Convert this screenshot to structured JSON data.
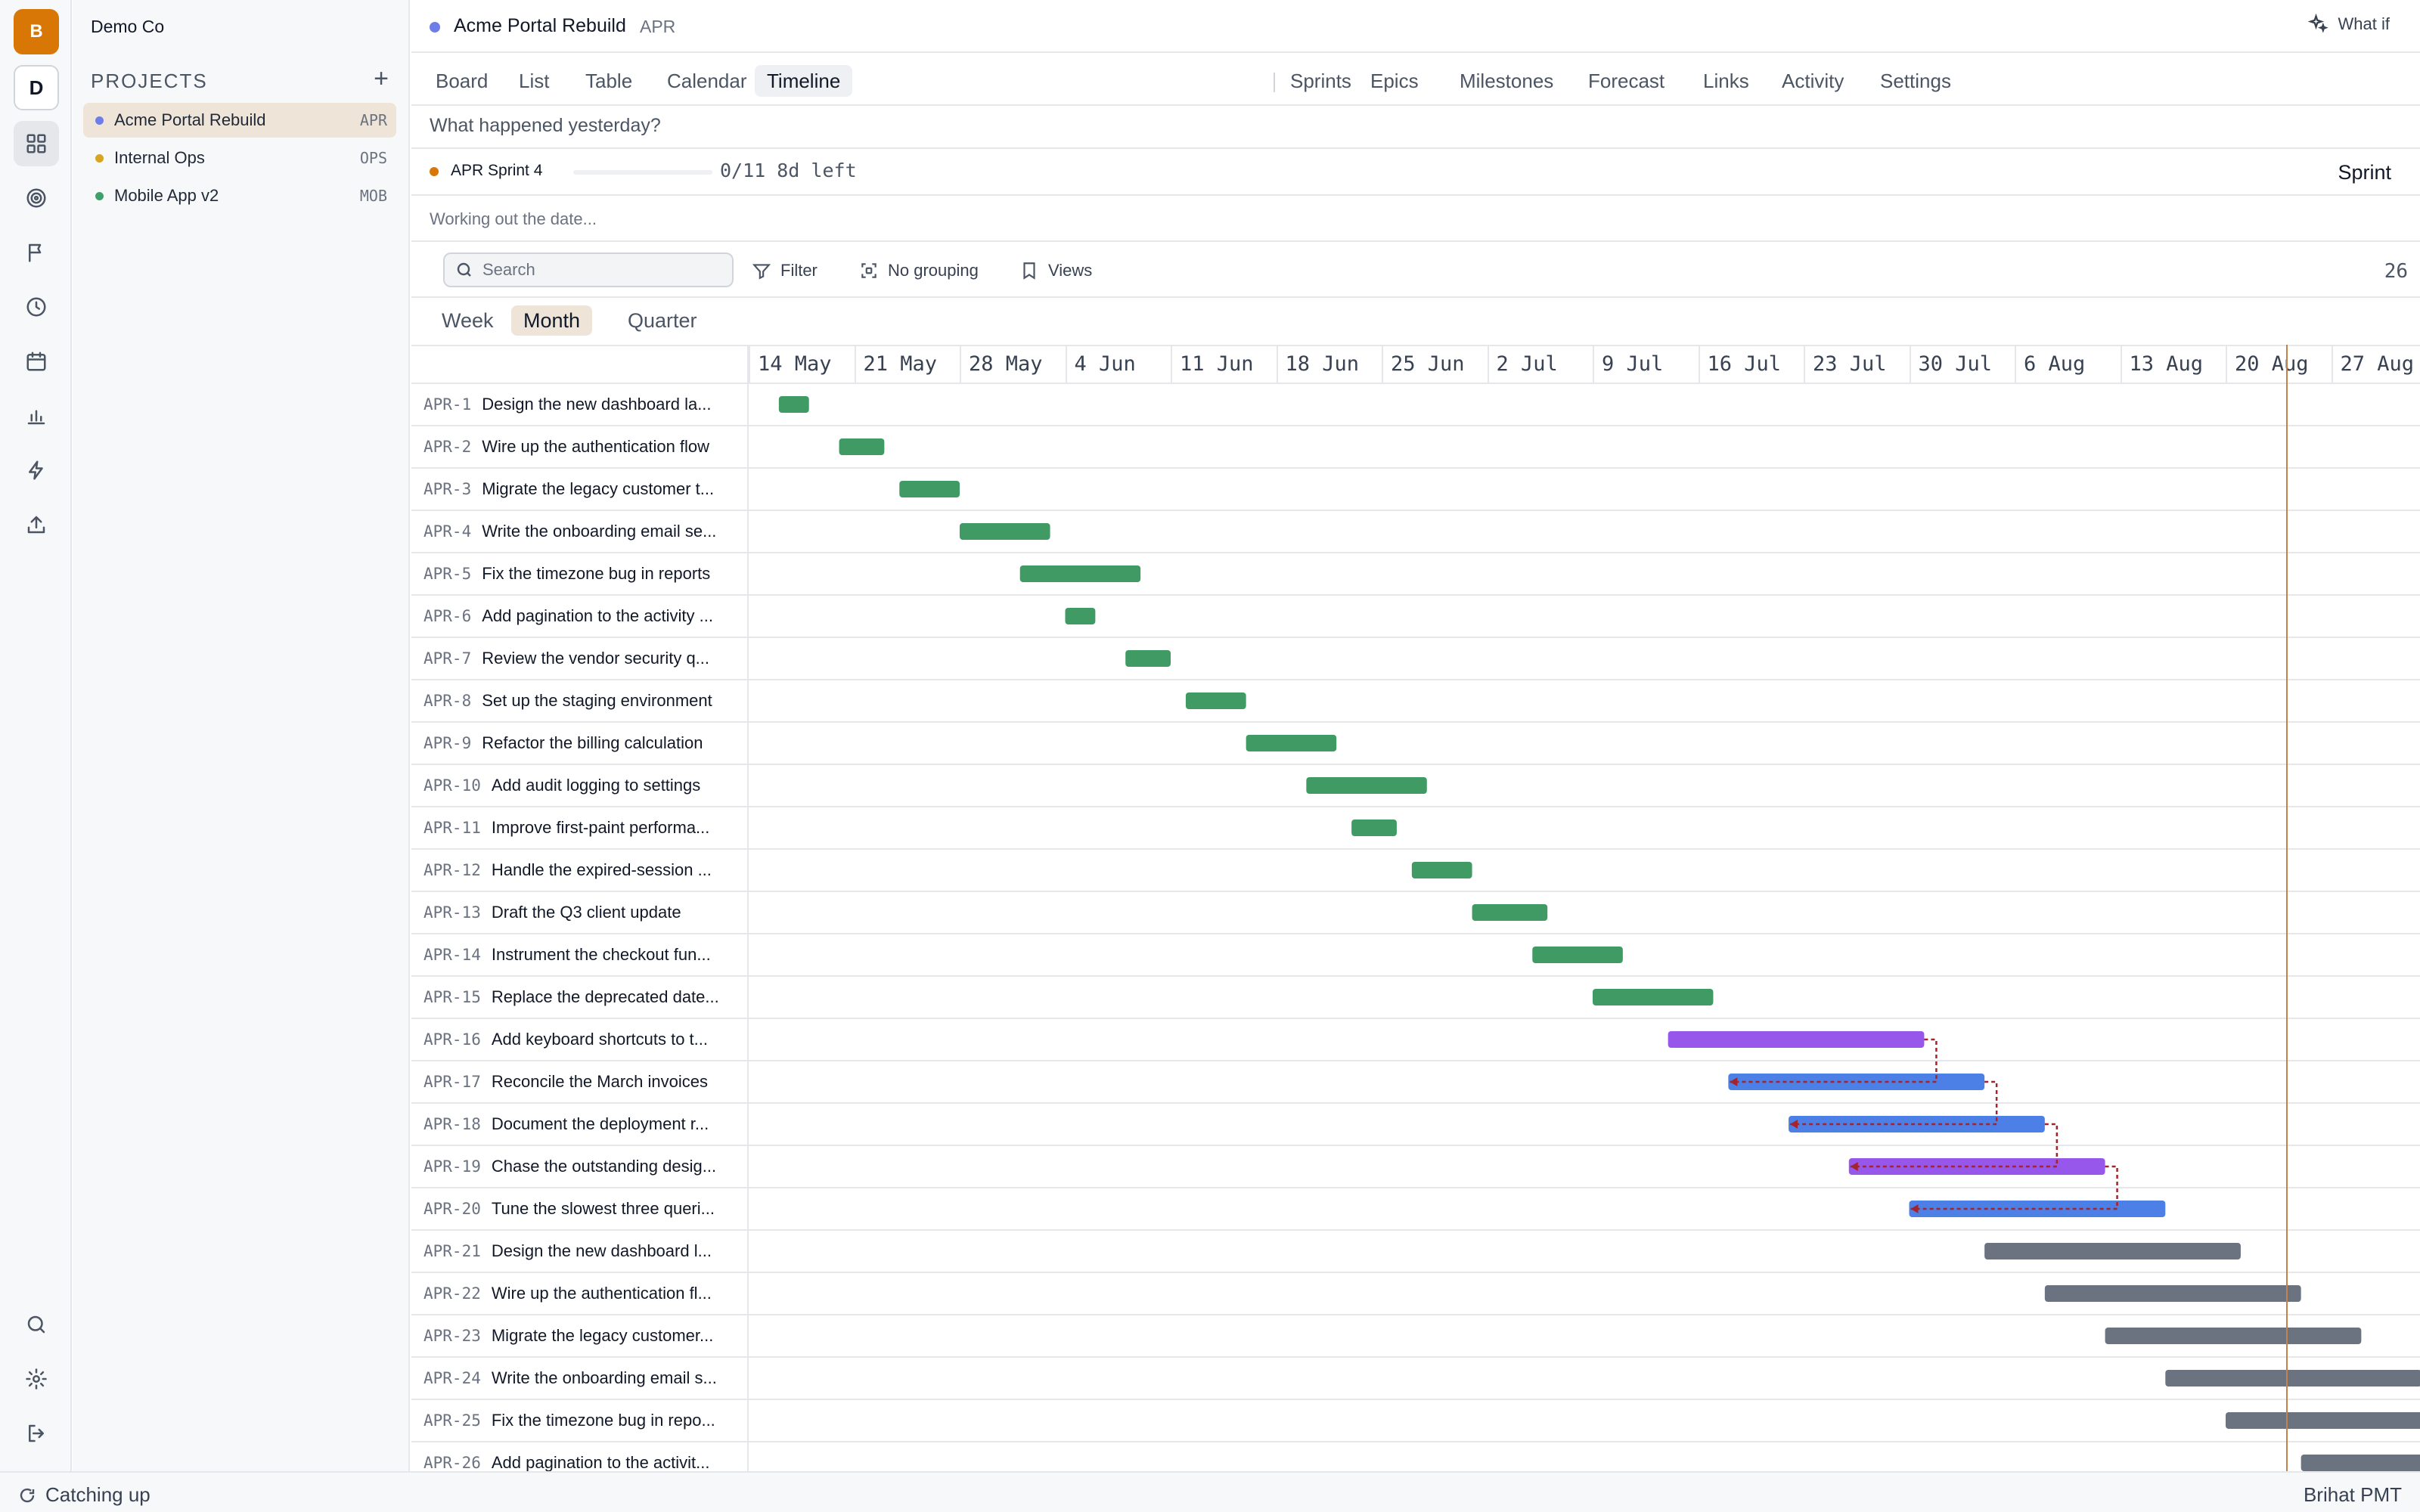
{
  "sidebar": {
    "workspaces": [
      {
        "letter": "B"
      },
      {
        "letter": "D"
      }
    ],
    "org_name": "Demo Co",
    "projects_heading": "PROJECTS",
    "projects": [
      {
        "name": "Acme Portal Rebuild",
        "key": "APR",
        "color": "#6d7ee8",
        "active": true
      },
      {
        "name": "Internal Ops",
        "key": "OPS",
        "color": "#d9a520",
        "active": false
      },
      {
        "name": "Mobile App v2",
        "key": "MOB",
        "color": "#3fa06a",
        "active": false
      }
    ]
  },
  "header": {
    "title": "Acme Portal Rebuild",
    "key": "APR",
    "what_if": "What if"
  },
  "tabs": [
    "Board",
    "List",
    "Table",
    "Calendar",
    "Timeline",
    "Sprints",
    "Epics",
    "Milestones",
    "Forecast",
    "Links",
    "Activity",
    "Settings"
  ],
  "active_tab": "Timeline",
  "standup_prompt": "What happened yesterday?",
  "sprint": {
    "name": "APR Sprint 4",
    "count": "0/11 8d left",
    "label": "Sprint",
    "progress": 0
  },
  "working_text": "Working out the date...",
  "toolbar": {
    "search_placeholder": "Search",
    "filter": "Filter",
    "grouping": "No grouping",
    "views": "Views",
    "count": "26"
  },
  "zoom": {
    "options": [
      "Week",
      "Month",
      "Quarter"
    ],
    "active": "Month"
  },
  "timeline": {
    "weeks": [
      "14 May",
      "21 May",
      "28 May",
      "4 Jun",
      "11 Jun",
      "18 Jun",
      "25 Jun",
      "2 Jul",
      "9 Jul",
      "16 Jul",
      "23 Jul",
      "30 Jul",
      "6 Aug",
      "13 Aug",
      "20 Aug",
      "27 Aug"
    ],
    "start_date": "14 May",
    "today": "24 Aug",
    "status_colors": {
      "done": "#3f9a63",
      "in_progress_purple": "#9757ea",
      "in_progress_blue": "#4d80e6",
      "todo": "#6b7280"
    },
    "tasks": [
      {
        "key": "APR-1",
        "title": "Design the new dashboard la...",
        "start": "16 May",
        "end": "18 May",
        "status": "done"
      },
      {
        "key": "APR-2",
        "title": "Wire up the authentication flow",
        "start": "20 May",
        "end": "23 May",
        "status": "done"
      },
      {
        "key": "APR-3",
        "title": "Migrate the legacy customer t...",
        "start": "24 May",
        "end": "28 May",
        "status": "done"
      },
      {
        "key": "APR-4",
        "title": "Write the onboarding email se...",
        "start": "28 May",
        "end": "3 Jun",
        "status": "done"
      },
      {
        "key": "APR-5",
        "title": "Fix the timezone bug in reports",
        "start": "1 Jun",
        "end": "9 Jun",
        "status": "done"
      },
      {
        "key": "APR-6",
        "title": "Add pagination to the activity ...",
        "start": "4 Jun",
        "end": "6 Jun",
        "status": "done"
      },
      {
        "key": "APR-7",
        "title": "Review the vendor security q...",
        "start": "8 Jun",
        "end": "11 Jun",
        "status": "done"
      },
      {
        "key": "APR-8",
        "title": "Set up the staging environment",
        "start": "12 Jun",
        "end": "16 Jun",
        "status": "done"
      },
      {
        "key": "APR-9",
        "title": "Refactor the billing calculation",
        "start": "16 Jun",
        "end": "22 Jun",
        "status": "done"
      },
      {
        "key": "APR-10",
        "title": "Add audit logging to settings",
        "start": "20 Jun",
        "end": "28 Jun",
        "status": "done"
      },
      {
        "key": "APR-11",
        "title": "Improve first-paint performa...",
        "start": "23 Jun",
        "end": "26 Jun",
        "status": "done"
      },
      {
        "key": "APR-12",
        "title": "Handle the expired-session ...",
        "start": "27 Jun",
        "end": "1 Jul",
        "status": "done"
      },
      {
        "key": "APR-13",
        "title": "Draft the Q3 client update",
        "start": "1 Jul",
        "end": "6 Jul",
        "status": "done"
      },
      {
        "key": "APR-14",
        "title": "Instrument the checkout fun...",
        "start": "5 Jul",
        "end": "11 Jul",
        "status": "done"
      },
      {
        "key": "APR-15",
        "title": "Replace the deprecated date...",
        "start": "9 Jul",
        "end": "17 Jul",
        "status": "done"
      },
      {
        "key": "APR-16",
        "title": "Add keyboard shortcuts to t...",
        "start": "14 Jul",
        "end": "31 Jul",
        "status": "in_progress_purple"
      },
      {
        "key": "APR-17",
        "title": "Reconcile the March invoices",
        "start": "18 Jul",
        "end": "4 Aug",
        "status": "in_progress_blue"
      },
      {
        "key": "APR-18",
        "title": "Document the deployment r...",
        "start": "22 Jul",
        "end": "8 Aug",
        "status": "in_progress_blue"
      },
      {
        "key": "APR-19",
        "title": "Chase the outstanding desig...",
        "start": "26 Jul",
        "end": "12 Aug",
        "status": "in_progress_purple"
      },
      {
        "key": "APR-20",
        "title": "Tune the slowest three queri...",
        "start": "30 Jul",
        "end": "16 Aug",
        "status": "in_progress_blue"
      },
      {
        "key": "APR-21",
        "title": "Design the new dashboard l...",
        "start": "4 Aug",
        "end": "21 Aug",
        "status": "todo"
      },
      {
        "key": "APR-22",
        "title": "Wire up the authentication fl...",
        "start": "8 Aug",
        "end": "25 Aug",
        "status": "todo"
      },
      {
        "key": "APR-23",
        "title": "Migrate the legacy customer...",
        "start": "12 Aug",
        "end": "29 Aug",
        "status": "todo"
      },
      {
        "key": "APR-24",
        "title": "Write the onboarding email s...",
        "start": "16 Aug",
        "end": "2 Sep",
        "status": "todo"
      },
      {
        "key": "APR-25",
        "title": "Fix the timezone bug in repo...",
        "start": "20 Aug",
        "end": "6 Sep",
        "status": "todo"
      },
      {
        "key": "APR-26",
        "title": "Add pagination to the activit...",
        "start": "25 Aug",
        "end": "11 Sep",
        "status": "todo"
      }
    ],
    "dependencies": [
      {
        "from": "APR-16",
        "to": "APR-17"
      },
      {
        "from": "APR-17",
        "to": "APR-18"
      },
      {
        "from": "APR-18",
        "to": "APR-19"
      },
      {
        "from": "APR-19",
        "to": "APR-20"
      }
    ]
  },
  "status_bar": {
    "left": "Catching up",
    "right": "Brihat PMT"
  }
}
